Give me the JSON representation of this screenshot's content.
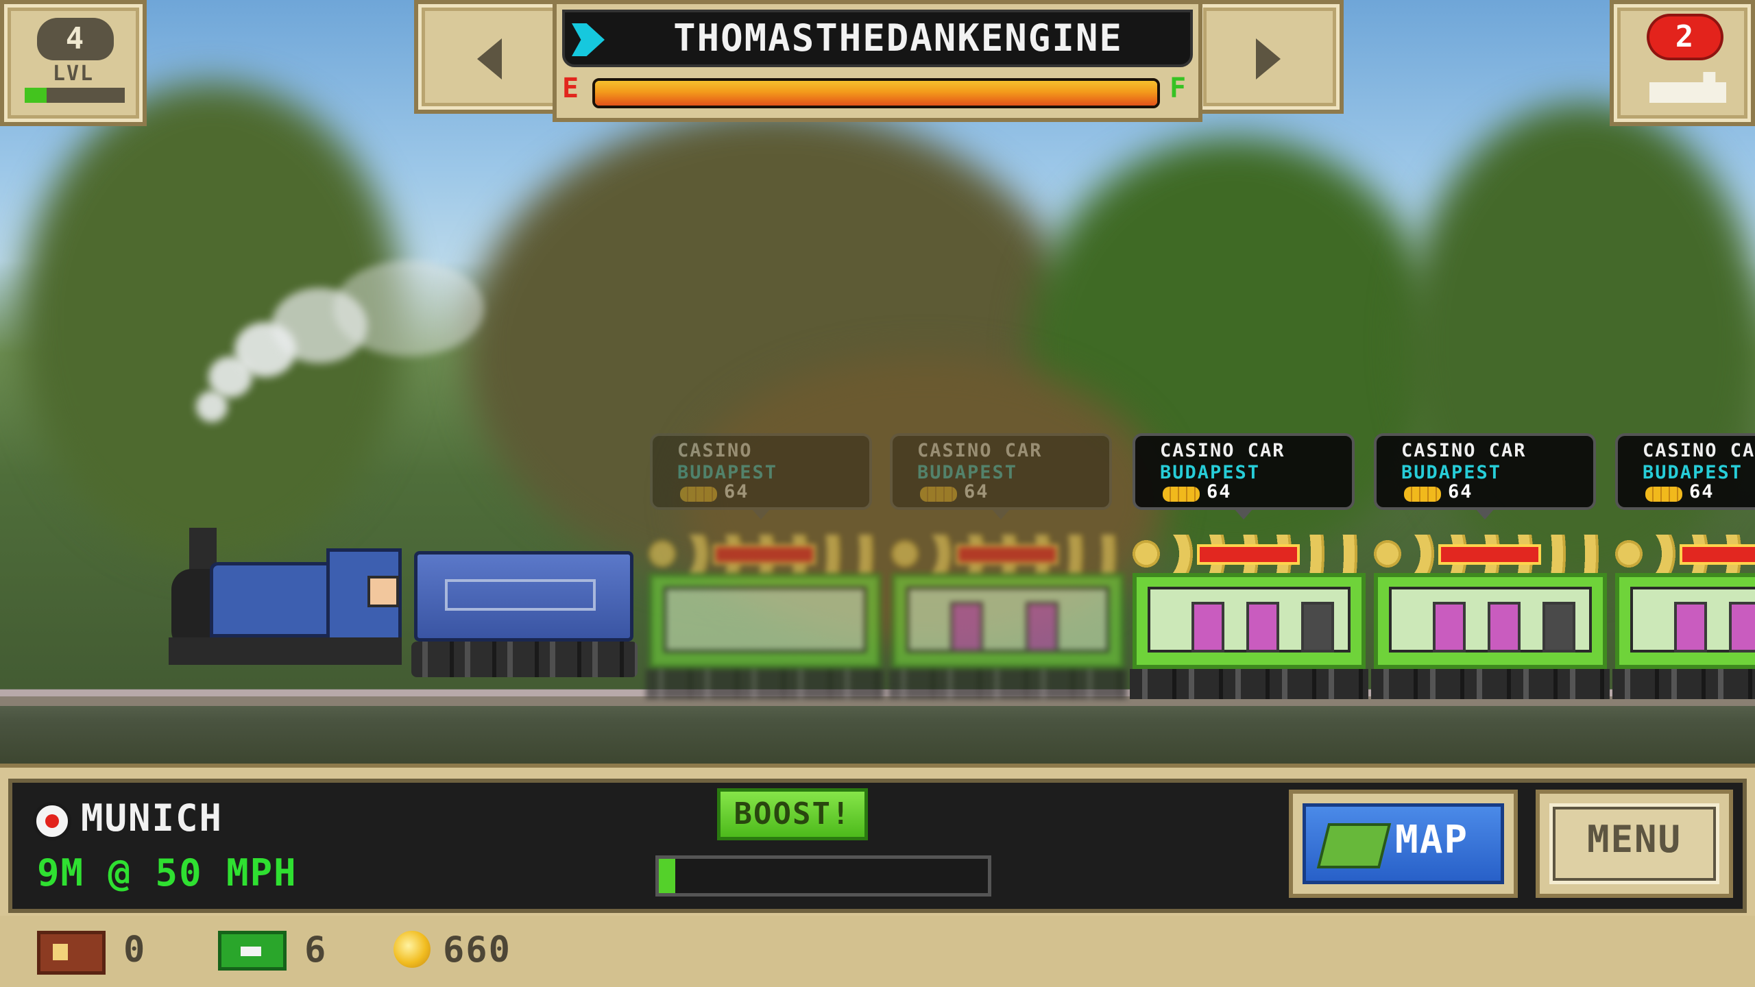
{
  "hud": {
    "level_value": "4",
    "level_label": "LVL",
    "level_progress": 0.22,
    "train_name": "THOMASTHEDANKENGINE",
    "fuel_empty_label": "E",
    "fuel_full_label": "F",
    "fuel_level": 1.0,
    "cars_count": "2",
    "prev_icon": "left-arrow-icon",
    "next_icon": "right-arrow-icon"
  },
  "cars": [
    {
      "title": "CASINO",
      "city": "BUDAPEST",
      "value": "64",
      "faded": true
    },
    {
      "title": "CASINO CAR",
      "city": "BUDAPEST",
      "value": "64",
      "faded": true
    },
    {
      "title": "CASINO CAR",
      "city": "BUDAPEST",
      "value": "64",
      "faded": false
    },
    {
      "title": "CASINO CAR",
      "city": "BUDAPEST",
      "value": "64",
      "faded": false
    },
    {
      "title": "CASINO CA",
      "city": "BUDAPEST",
      "value": "64",
      "faded": false
    }
  ],
  "status": {
    "station": "MUNICH",
    "distance_speed": "9M @ 50 MPH",
    "boost_label": "BOOST!",
    "boost_progress": 0.05,
    "map_label": "MAP",
    "menu_label": "MENU"
  },
  "resources": {
    "crates": "0",
    "cash": "6",
    "coins": "660"
  },
  "colors": {
    "panel_tan": "#d9c99a",
    "fuel_orange": "#f39a1b",
    "distance_green": "#2fe031",
    "city_cyan": "#27cdd8",
    "fuel_empty_red": "#e2261d",
    "fuel_full_green": "#37c224"
  }
}
